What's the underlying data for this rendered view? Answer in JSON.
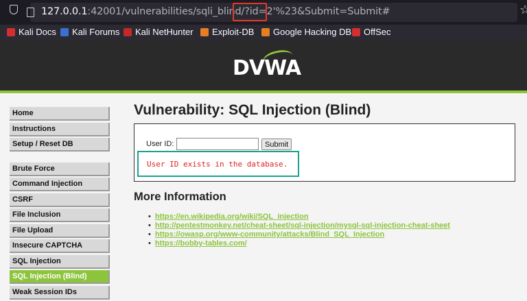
{
  "browser": {
    "url_host": "127.0.0.1",
    "url_rest_dim": ":42001/vulnerabilities/sqli_blind",
    "url_highlight": "/?id=2'%",
    "url_tail": "23&Submit=Submit#",
    "bookmarks": [
      {
        "label": "Kali Docs",
        "icon": "kali-docs-icon",
        "color": "#d32f2f"
      },
      {
        "label": "Kali Forums",
        "icon": "kali-forums-icon",
        "color": "#3c6fd1"
      },
      {
        "label": "Kali NetHunter",
        "icon": "nethunter-icon",
        "color": "#c62828"
      },
      {
        "label": "Exploit-DB",
        "icon": "exploit-db-icon",
        "color": "#e67e22"
      },
      {
        "label": "Google Hacking DB",
        "icon": "ghdb-icon",
        "color": "#e67e22"
      },
      {
        "label": "OffSec",
        "icon": "offsec-icon",
        "color": "#d32f2f"
      }
    ]
  },
  "header": {
    "logo_text": "DVWA"
  },
  "sidebar": {
    "group1": [
      "Home",
      "Instructions",
      "Setup / Reset DB"
    ],
    "group2": [
      "Brute Force",
      "Command Injection",
      "CSRF",
      "File Inclusion",
      "File Upload",
      "Insecure CAPTCHA",
      "SQL Injection",
      "SQL Injection (Blind)",
      "Weak Session IDs"
    ],
    "active": "SQL Injection (Blind)"
  },
  "main": {
    "title": "Vulnerability: SQL Injection (Blind)",
    "user_id_label": "User ID:",
    "user_id_value": "",
    "submit_label": "Submit",
    "result": "User ID exists in the database.",
    "more_title": "More Information",
    "links": [
      "https://en.wikipedia.org/wiki/SQL_injection",
      "http://pentestmonkey.net/cheat-sheet/sql-injection/mysql-sql-injection-cheat-sheet",
      "https://owasp.org/www-community/attacks/Blind_SQL_Injection",
      "https://bobby-tables.com/"
    ]
  },
  "colors": {
    "accent": "#8cc43c",
    "result_text": "#e02020",
    "highlight_red": "#e23a2a",
    "highlight_teal": "#1aa28f"
  }
}
